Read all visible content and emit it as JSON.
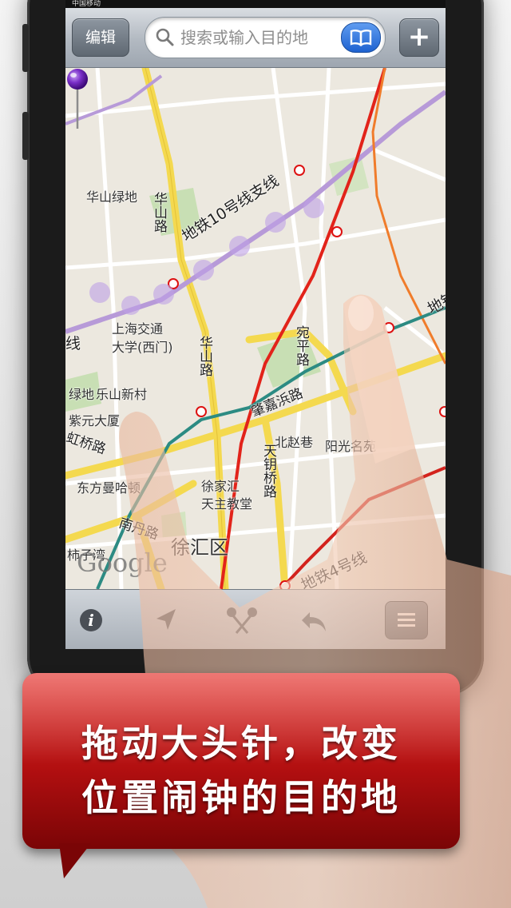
{
  "status": {
    "carrier": "中国移动"
  },
  "navbar": {
    "edit_label": "编辑",
    "search_placeholder": "搜索或输入目的地",
    "add_label": "+"
  },
  "map": {
    "metro_labels": {
      "line10_branch": "地铁10号线支线",
      "line4": "地铁4号线"
    },
    "places": {
      "huashan_green": "华山绿地",
      "sjtu_1": "上海交通",
      "sjtu_2": "大学(西门)",
      "leshan": "乐山新村",
      "ziyuan": "紫元大厦",
      "dongfang": "东方曼哈顿",
      "beizhao": "北赵巷",
      "yangguang": "阳光名苑",
      "xujiahui_1": "徐家汇",
      "xujiahui_2": "天主教堂",
      "xuhui": "徐汇区",
      "shizi": "柿子湾",
      "green_edge": "绿地"
    },
    "roads": {
      "huashan_top": "华山路",
      "huashan_mid": "华山路",
      "wanping": "宛平路",
      "zhaojiabang": "肇嘉浜路",
      "tianyaoqiao": "天钥桥路",
      "hongqiao": "虹桥路",
      "nandan": "南丹路"
    },
    "line_edge_labels": {
      "left": "线",
      "right": "地铁"
    },
    "attribution": "Google"
  },
  "toolbar": {
    "items": [
      "info-icon",
      "location-arrow-icon",
      "pin-drop-icon",
      "undo-icon",
      "list-icon"
    ]
  },
  "callout": {
    "line1": "拖动大头针，改变",
    "line2": "位置闹钟的目的地"
  },
  "colors": {
    "callout_red": "#c41a16",
    "pin_purple": "#6a1bb0",
    "metro_purple": "#b79ad8",
    "metro_red": "#e2231a",
    "metro_teal": "#2c8b83"
  }
}
